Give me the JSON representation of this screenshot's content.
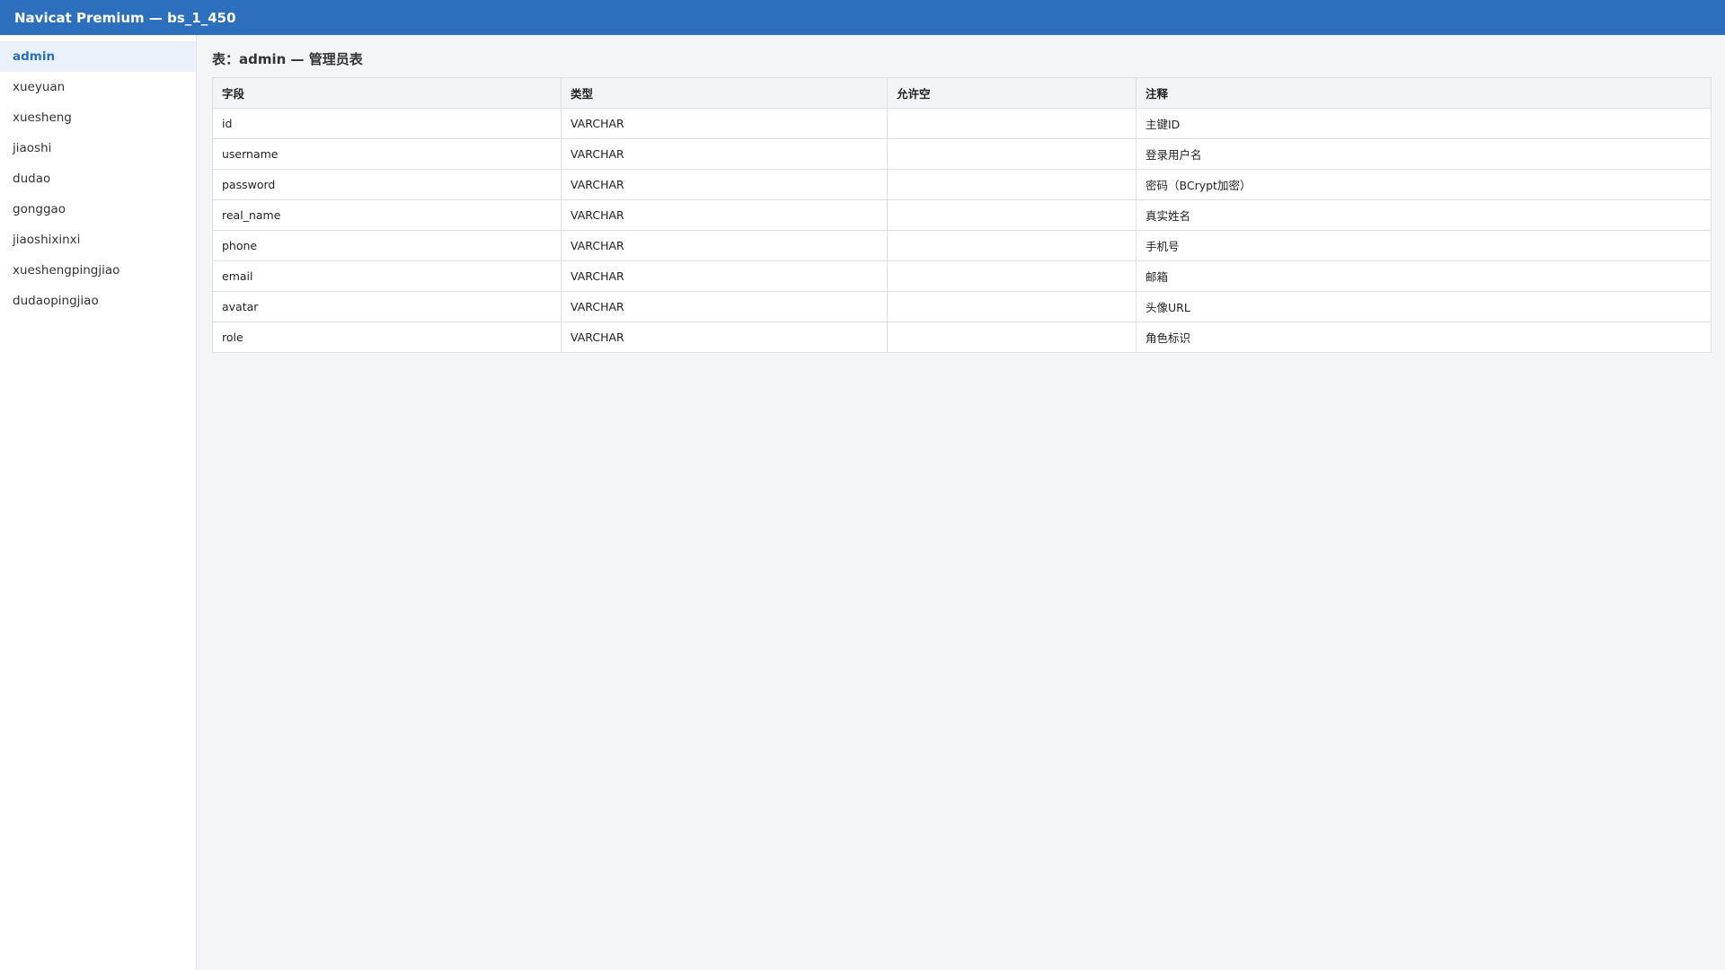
{
  "window": {
    "title": "Navicat Premium — bs_1_450"
  },
  "sidebar": {
    "items": [
      {
        "label": "admin",
        "active": true
      },
      {
        "label": "xueyuan",
        "active": false
      },
      {
        "label": "xuesheng",
        "active": false
      },
      {
        "label": "jiaoshi",
        "active": false
      },
      {
        "label": "dudao",
        "active": false
      },
      {
        "label": "gonggao",
        "active": false
      },
      {
        "label": "jiaoshixinxi",
        "active": false
      },
      {
        "label": "xueshengpingjiao",
        "active": false
      },
      {
        "label": "dudaopingjiao",
        "active": false
      }
    ]
  },
  "main": {
    "title": "表：admin — 管理员表",
    "table": {
      "columns": [
        "字段",
        "类型",
        "允许空",
        "注释"
      ],
      "rows": [
        [
          "id",
          "VARCHAR",
          "",
          "主键ID"
        ],
        [
          "username",
          "VARCHAR",
          "",
          "登录用户名"
        ],
        [
          "password",
          "VARCHAR",
          "",
          "密码（BCrypt加密）"
        ],
        [
          "real_name",
          "VARCHAR",
          "",
          "真实姓名"
        ],
        [
          "phone",
          "VARCHAR",
          "",
          "手机号"
        ],
        [
          "email",
          "VARCHAR",
          "",
          "邮箱"
        ],
        [
          "avatar",
          "VARCHAR",
          "",
          "头像URL"
        ],
        [
          "role",
          "VARCHAR",
          "",
          "角色标识"
        ]
      ]
    }
  },
  "colors": {
    "titlebar": "#2b6fbd",
    "active_item_bg": "#e9f1fb",
    "active_item_text": "#2b6fbd",
    "page_bg": "#f4f5f7"
  }
}
